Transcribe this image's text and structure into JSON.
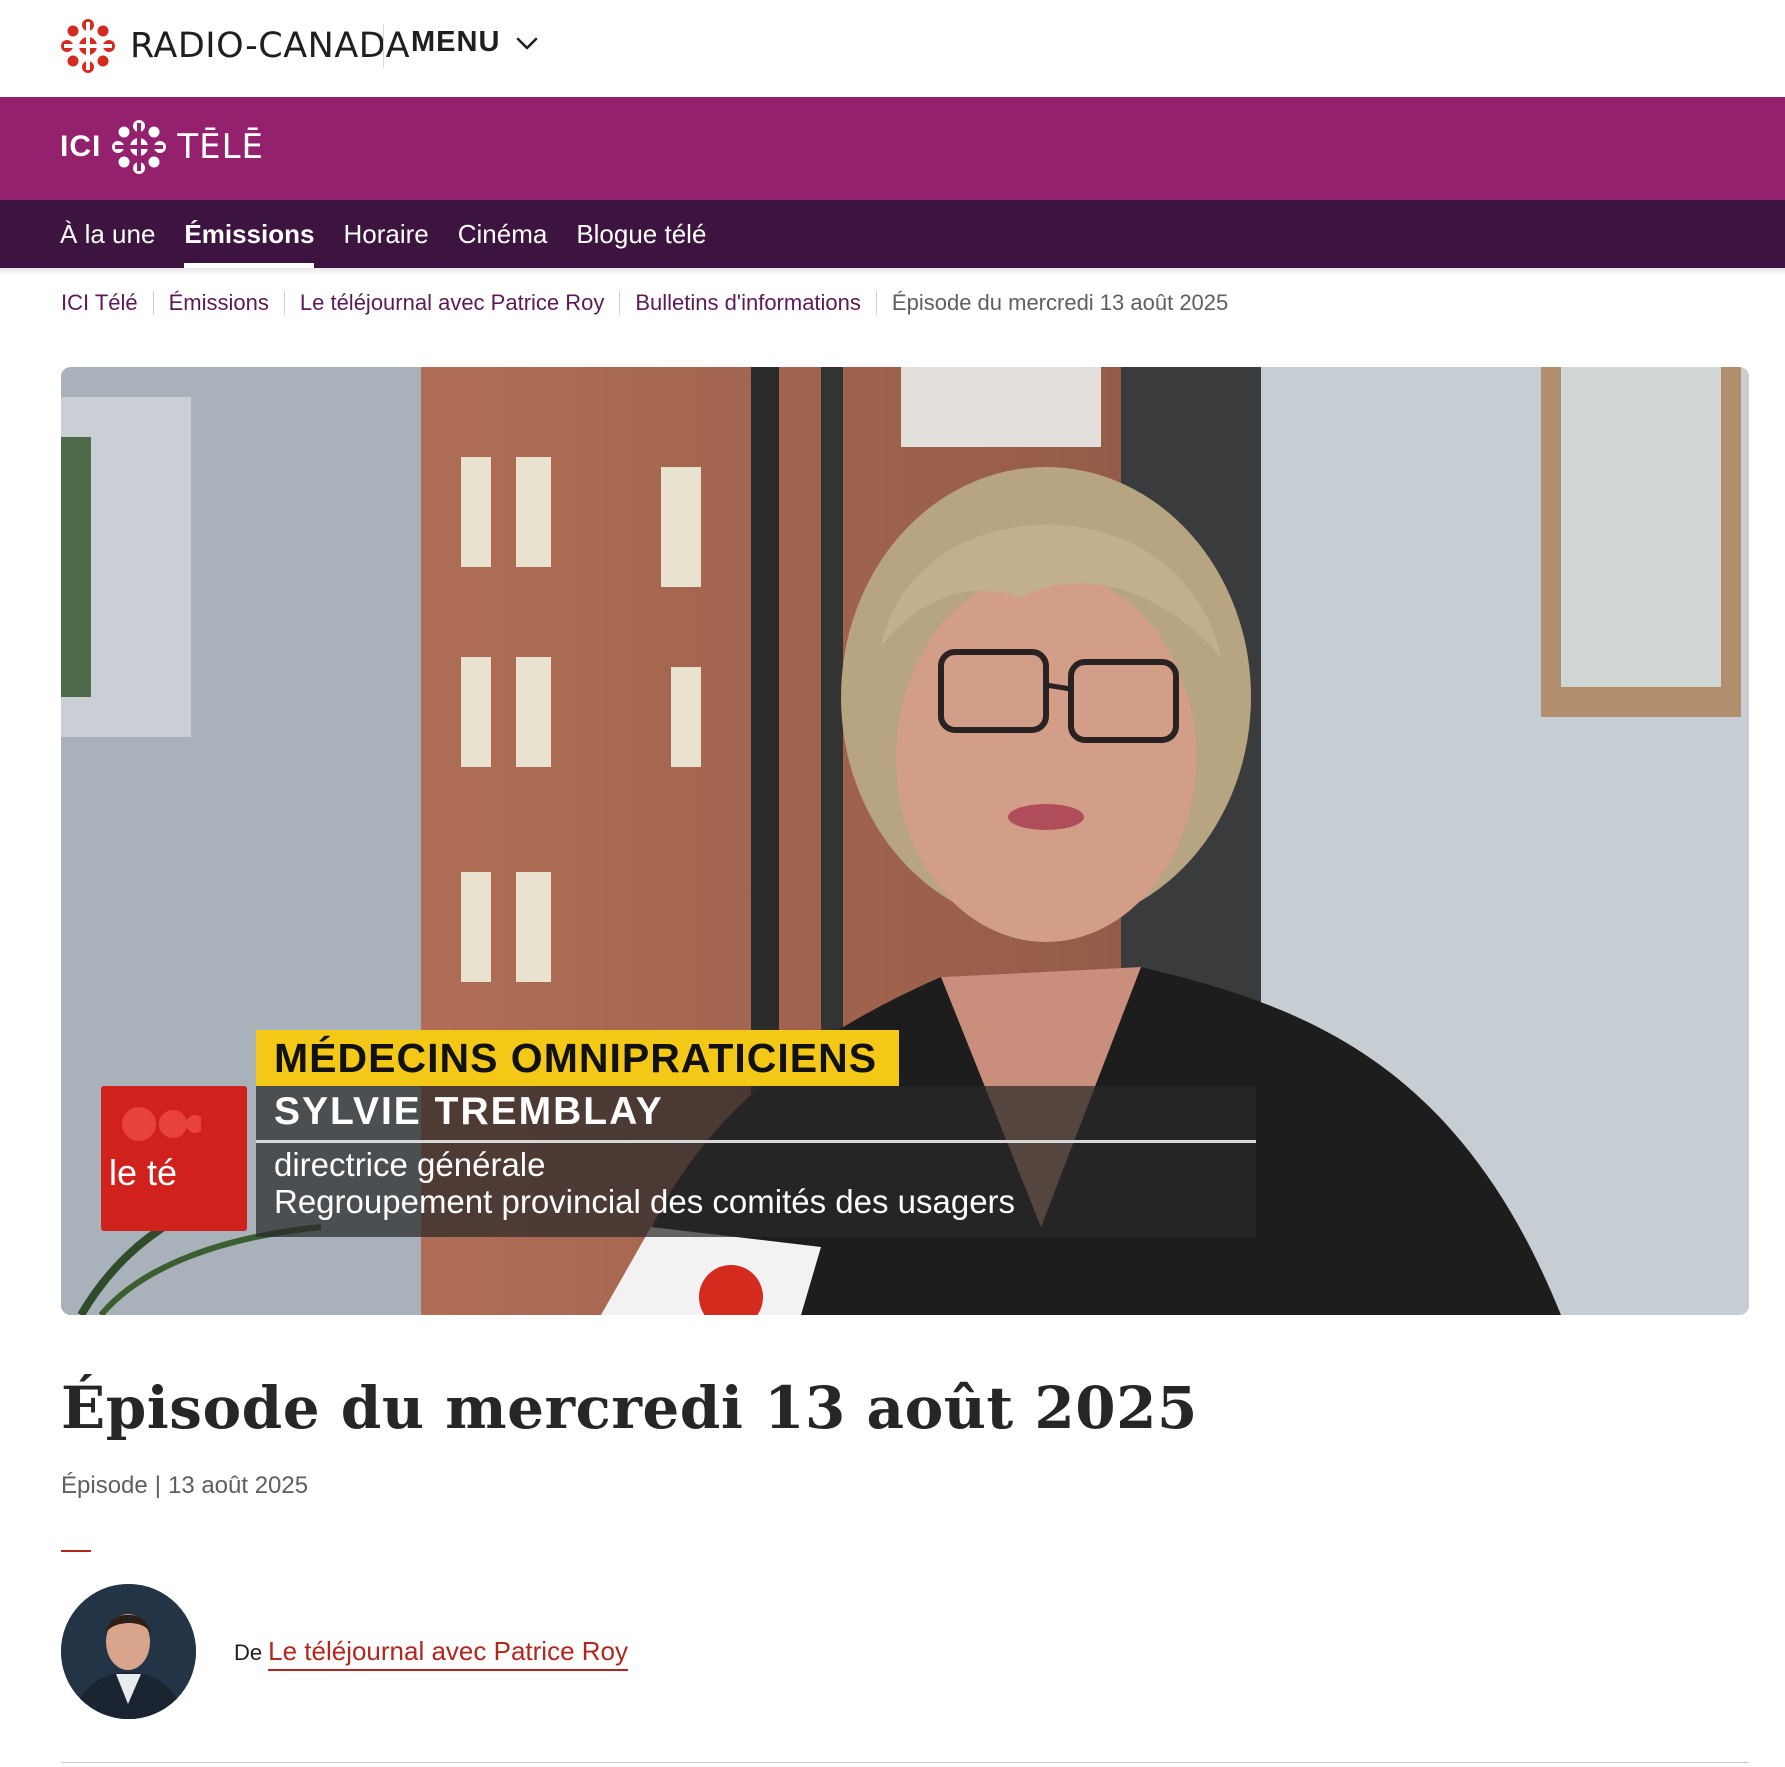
{
  "header": {
    "brand": "RADIO-CANADA",
    "menu_label": "MENU",
    "brand_color": "#d52b1e"
  },
  "tele_band": {
    "ici": "ICI",
    "tele": "TĒLĒ",
    "band_color": "#93216d"
  },
  "nav": {
    "items": [
      "À la une",
      "Émissions",
      "Horaire",
      "Cinéma",
      "Blogue télé"
    ],
    "active": "Émissions",
    "bg_color": "#3c143f"
  },
  "breadcrumb": {
    "items": [
      "ICI Télé",
      "Émissions",
      "Le téléjournal avec Patrice Roy",
      "Bulletins d'informations"
    ],
    "current": "Épisode du mercredi 13 août 2025"
  },
  "video": {
    "lower_third_title": "MÉDECINS OMNIPRATICIENS",
    "person_name": "SYLVIE TREMBLAY",
    "role_line1": "directrice générale",
    "role_line2": "Regroupement provincial des comités des usagers",
    "show_badge": "le té"
  },
  "episode": {
    "title": "Épisode du mercredi 13 août 2025",
    "type": "Épisode",
    "date": "13 août 2025"
  },
  "author": {
    "prefix": "De",
    "show_link": "Le téléjournal avec Patrice Roy",
    "accent_color": "#b3261e"
  }
}
